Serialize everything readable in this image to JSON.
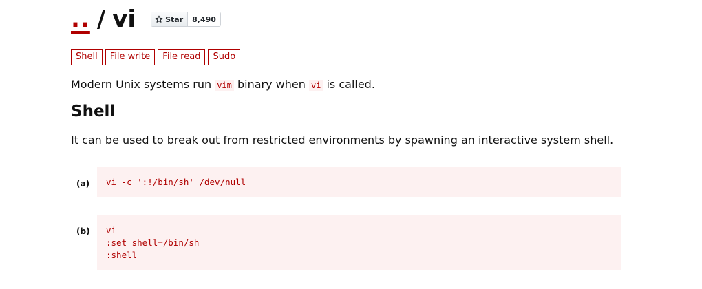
{
  "header": {
    "parent_link": "..",
    "separator": "/",
    "binary_name": "vi",
    "github": {
      "star_label": "Star",
      "star_count": "8,490",
      "icon": "star-icon"
    }
  },
  "functions": [
    "Shell",
    "File write",
    "File read",
    "Sudo"
  ],
  "intro": {
    "before": "Modern Unix systems run ",
    "vim_link": "vim",
    "middle": " binary when ",
    "vi_code": "vi",
    "after": " is called."
  },
  "shell_section": {
    "heading": "Shell",
    "description": "It can be used to break out from restricted environments by spawning an interactive system shell.",
    "examples": [
      {
        "label": "(a)",
        "code": "vi -c ':!/bin/sh' /dev/null"
      },
      {
        "label": "(b)",
        "code": "vi\n:set shell=/bin/sh\n:shell"
      }
    ]
  },
  "colors": {
    "accent": "#b00000",
    "code_bg": "#fdf1f1"
  }
}
